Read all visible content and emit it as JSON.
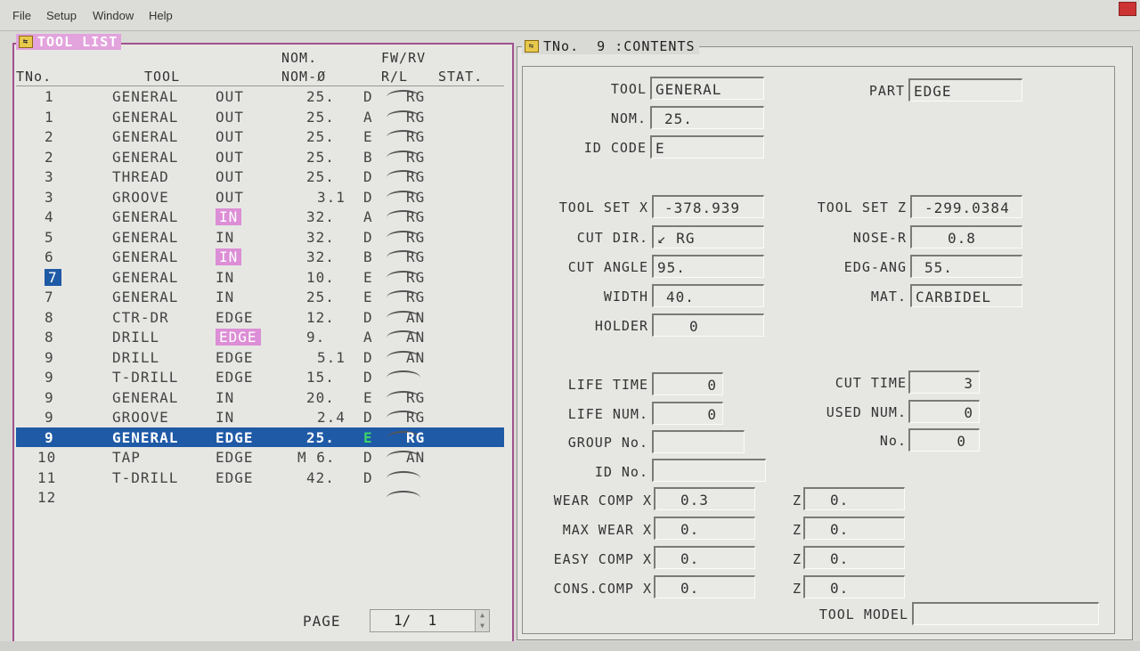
{
  "menubar": {
    "file": "File",
    "setup": "Setup",
    "window": "Window",
    "help": "Help"
  },
  "tool_list": {
    "title": "TOOL LIST",
    "headers": {
      "tno": "TNo.",
      "tool": "TOOL",
      "nom1": "NOM.",
      "nom2": "NOM-Ø",
      "fwrv": "FW/RV",
      "rl": "R/L",
      "stat": "STAT."
    },
    "rows": [
      {
        "tno": "1",
        "tool": "GENERAL",
        "pos": "OUT",
        "nom": "25.",
        "code": "D",
        "dir": "RG"
      },
      {
        "tno": "1",
        "tool": "GENERAL",
        "pos": "OUT",
        "nom": "25.",
        "code": "A",
        "dir": "RG"
      },
      {
        "tno": "2",
        "tool": "GENERAL",
        "pos": "OUT",
        "nom": "25.",
        "code": "E",
        "dir": "RG"
      },
      {
        "tno": "2",
        "tool": "GENERAL",
        "pos": "OUT",
        "nom": "25.",
        "code": "B",
        "dir": "RG"
      },
      {
        "tno": "3",
        "tool": "THREAD",
        "pos": "OUT",
        "nom": "25.",
        "code": "D",
        "dir": "RG"
      },
      {
        "tno": "3",
        "tool": "GROOVE",
        "pos": "OUT",
        "nom": "3.1",
        "code": "D",
        "dir": "RG"
      },
      {
        "tno": "4",
        "tool": "GENERAL",
        "pos": "IN",
        "nom": "32.",
        "code": "A",
        "dir": "RG"
      },
      {
        "tno": "5",
        "tool": "GENERAL",
        "pos": "IN",
        "nom": "32.",
        "code": "D",
        "dir": "RG"
      },
      {
        "tno": "6",
        "tool": "GENERAL",
        "pos": "IN",
        "nom": "32.",
        "code": "B",
        "dir": "RG"
      },
      {
        "tno": "7",
        "tool": "GENERAL",
        "pos": "IN",
        "nom": "10.",
        "code": "E",
        "dir": "RG"
      },
      {
        "tno": "7",
        "tool": "GENERAL",
        "pos": "IN",
        "nom": "25.",
        "code": "E",
        "dir": "RG"
      },
      {
        "tno": "8",
        "tool": "CTR-DR",
        "pos": "EDGE",
        "nom": "12.",
        "code": "D",
        "dir": "AN"
      },
      {
        "tno": "8",
        "tool": "DRILL",
        "pos": "EDGE",
        "nom": "9.",
        "code": "A",
        "dir": "AN"
      },
      {
        "tno": "9",
        "tool": "DRILL",
        "pos": "EDGE",
        "nom": "5.1",
        "code": "D",
        "dir": "AN"
      },
      {
        "tno": "9",
        "tool": "T-DRILL",
        "pos": "EDGE",
        "nom": "15.",
        "code": "D",
        "dir": ""
      },
      {
        "tno": "9",
        "tool": "GENERAL",
        "pos": "IN",
        "nom": "20.",
        "code": "E",
        "dir": "RG"
      },
      {
        "tno": "9",
        "tool": "GROOVE",
        "pos": "IN",
        "nom": "2.4",
        "code": "D",
        "dir": "RG"
      },
      {
        "tno": "9",
        "tool": "GENERAL",
        "pos": "EDGE",
        "nom": "25.",
        "code": "E",
        "dir": "RG"
      },
      {
        "tno": "10",
        "tool": "TAP",
        "pos": "EDGE",
        "nom": "M 6.",
        "code": "D",
        "dir": "AN"
      },
      {
        "tno": "11",
        "tool": "T-DRILL",
        "pos": "EDGE",
        "nom": "42.",
        "code": "D",
        "dir": ""
      },
      {
        "tno": "12",
        "tool": "",
        "pos": "",
        "nom": "",
        "code": "",
        "dir": ""
      }
    ],
    "page_label": "PAGE",
    "page_value": "1/  1"
  },
  "contents": {
    "title": "TNo.  9 :CONTENTS",
    "tool_label": "TOOL",
    "tool": "GENERAL",
    "part_label": "PART",
    "part": "EDGE",
    "nom_label": "NOM.",
    "nom": "25.",
    "idcode_label": "ID CODE",
    "idcode": "E",
    "toolset_x_label": "TOOL SET X",
    "toolset_x": "-378.939",
    "toolset_z_label": "TOOL SET Z",
    "toolset_z": "-299.0384",
    "cutdir_label": "CUT DIR.",
    "cutdir": "RG",
    "noser_label": "NOSE-R",
    "noser": "0.8",
    "cutangle_label": "CUT ANGLE",
    "cutangle": "95.",
    "edgang_label": "EDG-ANG",
    "edgang": "55.",
    "width_label": "WIDTH",
    "width": "40.",
    "mat_label": "MAT.",
    "mat": "CARBIDEL",
    "holder_label": "HOLDER",
    "holder": "0",
    "lifetime_label": "LIFE TIME",
    "lifetime": "0",
    "cuttime_label": "CUT TIME",
    "cuttime": "3",
    "lifenum_label": "LIFE NUM.",
    "lifenum": "0",
    "usednum_label": "USED NUM.",
    "usednum": "0",
    "groupno_label": "GROUP No.",
    "groupno": "",
    "no_label": "No.",
    "no": "0",
    "idno_label": "ID No.",
    "idno": "",
    "wear_label": "WEAR COMP X",
    "wear_x": "0.3",
    "wear_z": "0.",
    "maxwear_label": "MAX WEAR X",
    "maxwear_x": "0.",
    "maxwear_z": "0.",
    "easy_label": "EASY COMP X",
    "easy_x": "0.",
    "easy_z": "0.",
    "cons_label": "CONS.COMP X",
    "cons_x": "0.",
    "cons_z": "0.",
    "z_label": "Z",
    "toolmodel_label": "TOOL MODEL",
    "toolmodel": ""
  },
  "colors": {
    "selection": "#1f5aa6",
    "highlight": "#dc8ed6",
    "frame": "#a0528c"
  }
}
